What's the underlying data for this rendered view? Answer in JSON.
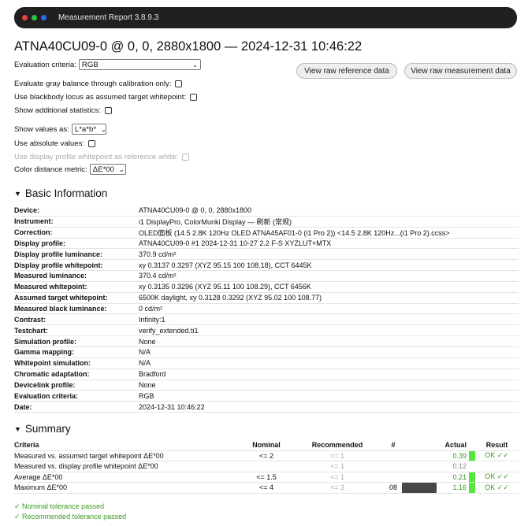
{
  "window": {
    "title": "Measurement Report 3.8.9.3",
    "traffic_lights": [
      "close",
      "minimize",
      "maximize"
    ],
    "colors": {
      "close": "#e8453c",
      "minimize": "#2fc24a",
      "maximize": "#2b6df0"
    }
  },
  "report": {
    "title": "ATNA40CU09-0 @ 0, 0, 2880x1800 — 2024-12-31 10:46:22"
  },
  "options": {
    "evaluation_criteria_label": "Evaluation criteria:",
    "evaluation_criteria_value": "RGB",
    "gray_balance_label": "Evaluate gray balance through calibration only:",
    "blackbody_label": "Use blackbody locus as assumed target whitepoint:",
    "additional_stats_label": "Show additional statistics:",
    "show_values_label": "Show values as:",
    "show_values_value": "L*a*b*",
    "absolute_values_label": "Use absolute values:",
    "display_profile_wp_label": "Use display profile whitepoint as reference white:",
    "color_distance_label": "Color distance metric:",
    "color_distance_value": "ΔE*00"
  },
  "buttons": {
    "raw_reference": "View raw reference data",
    "raw_measurement": "View raw measurement data"
  },
  "basic_info": {
    "heading": "Basic Information",
    "rows": [
      {
        "key": "Device:",
        "value": "ATNA40CU09-0 @ 0, 0, 2880x1800"
      },
      {
        "key": "Instrument:",
        "value": "i1 DisplayPro, ColorMunki Display — 刷新 (常规)"
      },
      {
        "key": "Correction:",
        "value": "OLED面板 (14.5 2.8K 120Hz OLED ATNA45AF01-0 (i1 Pro 2)) <14.5 2.8K 120Hz...(i1 Pro 2).ccss>"
      },
      {
        "key": "Display profile:",
        "value": "ATNA40CU09-0 #1 2024-12-31 10-27 2.2 F-S XYZLUT+MTX"
      },
      {
        "key": "Display profile luminance:",
        "value": "370.9 cd/m²"
      },
      {
        "key": "Display profile whitepoint:",
        "value": "xy 0.3137 0.3297 (XYZ 95.15 100 108.18), CCT 6445K"
      },
      {
        "key": "Measured luminance:",
        "value": "370.4 cd/m²"
      },
      {
        "key": "Measured whitepoint:",
        "value": "xy 0.3135 0.3296 (XYZ 95.11 100 108.29), CCT 6456K"
      },
      {
        "key": "Assumed target whitepoint:",
        "value": "6500K daylight, xy 0.3128 0.3292 (XYZ 95.02 100 108.77)"
      },
      {
        "key": "Measured black luminance:",
        "value": "0 cd/m²"
      },
      {
        "key": "Contrast:",
        "value": "Infinity:1"
      },
      {
        "key": "Testchart:",
        "value": "verify_extended.ti1"
      },
      {
        "key": "Simulation profile:",
        "value": "None"
      },
      {
        "key": "Gamma mapping:",
        "value": "N/A"
      },
      {
        "key": "Whitepoint simulation:",
        "value": "N/A"
      },
      {
        "key": "Chromatic adaptation:",
        "value": "Bradford"
      },
      {
        "key": "Devicelink profile:",
        "value": "None"
      },
      {
        "key": "Evaluation criteria:",
        "value": "RGB"
      },
      {
        "key": "Date:",
        "value": "2024-12-31 10:46:22"
      }
    ]
  },
  "summary": {
    "heading": "Summary",
    "columns": {
      "criteria": "Criteria",
      "nominal": "Nominal",
      "recommended": "Recommended",
      "hash": "#",
      "actual": "Actual",
      "result": "Result"
    },
    "rows": [
      {
        "criteria": "Measured vs. assumed target whitepoint ΔE*00",
        "nominal": "<= 2",
        "recommended": "<= 1",
        "hash": "",
        "actual": "0.39",
        "actual_state": "pass",
        "result": "OK ✓✓"
      },
      {
        "criteria": "Measured vs. display profile whitepoint ΔE*00",
        "nominal": "",
        "recommended": "<= 1",
        "hash": "",
        "actual": "0.12",
        "actual_state": "neutral",
        "result": ""
      },
      {
        "criteria": "Average ΔE*00",
        "nominal": "<= 1.5",
        "recommended": "<= 1",
        "hash": "",
        "actual": "0.21",
        "actual_state": "pass",
        "result": "OK ✓✓"
      },
      {
        "criteria": "Maximum ΔE*00",
        "nominal": "<= 4",
        "recommended": "<= 3",
        "hash": "08",
        "actual": "1.16",
        "actual_state": "pass",
        "result": "OK ✓✓",
        "swatch_color": "#474747"
      }
    ],
    "colors": {
      "pass": "#3a9a1f",
      "indicator": "#55e63a",
      "neutral": "#888888"
    },
    "nominal_passed": "✓ Nominal tolerance passed",
    "recommended_passed": "✓ Recommended tolerance passed"
  }
}
